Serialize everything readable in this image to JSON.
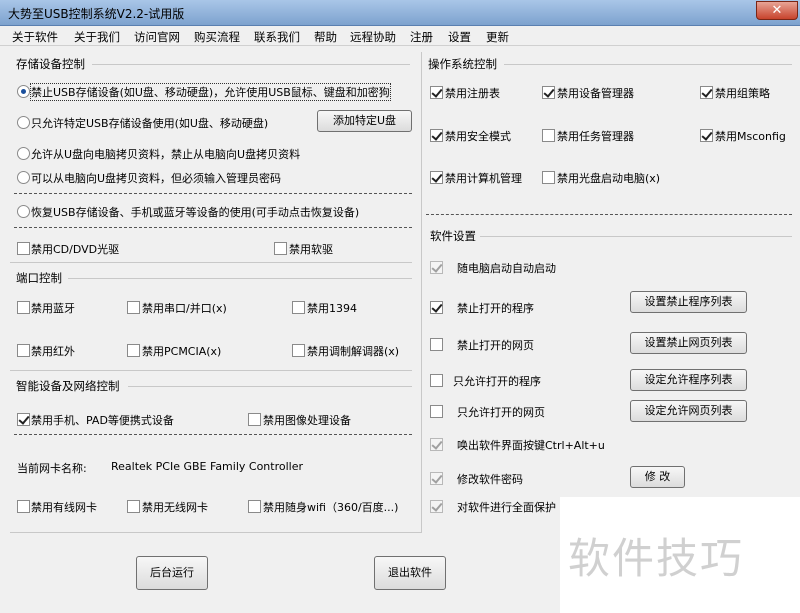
{
  "window": {
    "title": "大势至USB控制系统V2.2-试用版",
    "close_label": "✕"
  },
  "menu": [
    "关于软件",
    "关于我们",
    "访问官网",
    "购买流程",
    "联系我们",
    "帮助",
    "远程协助",
    "注册",
    "设置",
    "更新"
  ],
  "storage": {
    "title": "存储设备控制",
    "radios": [
      {
        "label": "禁止USB存储设备(如U盘、移动硬盘)，允许使用USB鼠标、键盘和加密狗",
        "checked": true
      },
      {
        "label": "只允许特定USB存储设备使用(如U盘、移动硬盘)",
        "checked": false
      },
      {
        "label": "允许从U盘向电脑拷贝资料，禁止从电脑向U盘拷贝资料",
        "checked": false
      },
      {
        "label": "可以从电脑向U盘拷贝资料，但必须输入管理员密码",
        "checked": false
      },
      {
        "label": "恢复USB存储设备、手机或蓝牙等设备的使用(可手动点击恢复设备)",
        "checked": false
      }
    ],
    "add_specific_button": "添加特定U盘",
    "cd_dvd": {
      "label": "禁用CD/DVD光驱",
      "checked": false
    },
    "floppy": {
      "label": "禁用软驱",
      "checked": false
    }
  },
  "ports": {
    "title": "端口控制",
    "items": [
      {
        "label": "禁用蓝牙",
        "checked": false
      },
      {
        "label": "禁用串口/并口(x)",
        "checked": false
      },
      {
        "label": "禁用1394",
        "checked": false
      },
      {
        "label": "禁用红外",
        "checked": false
      },
      {
        "label": "禁用PCMCIA(x)",
        "checked": false
      },
      {
        "label": "禁用调制解调器(x)",
        "checked": false
      }
    ]
  },
  "smart": {
    "title": "智能设备及网络控制",
    "portable": {
      "label": "禁用手机、PAD等便携式设备",
      "checked": true
    },
    "imaging": {
      "label": "禁用图像处理设备",
      "checked": false
    },
    "nic_label": "当前网卡名称:",
    "nic_value": "Realtek PCIe GBE Family Controller",
    "net_items": [
      {
        "label": "禁用有线网卡",
        "checked": false
      },
      {
        "label": "禁用无线网卡",
        "checked": false
      },
      {
        "label": "禁用随身wifi（360/百度...)",
        "checked": false
      }
    ]
  },
  "os": {
    "title": "操作系统控制",
    "items": [
      {
        "label": "禁用注册表",
        "checked": true
      },
      {
        "label": "禁用设备管理器",
        "checked": true
      },
      {
        "label": "禁用组策略",
        "checked": true
      },
      {
        "label": "禁用安全模式",
        "checked": true
      },
      {
        "label": "禁用任务管理器",
        "checked": false
      },
      {
        "label": "禁用Msconfig",
        "checked": true
      },
      {
        "label": "禁用计算机管理",
        "checked": true
      },
      {
        "label": "禁用光盘启动电脑(x)",
        "checked": false
      }
    ]
  },
  "software": {
    "title": "软件设置",
    "items": [
      {
        "label": "随电脑启动自动启动",
        "checked": true,
        "disabled": true
      },
      {
        "label": "禁止打开的程序",
        "checked": true,
        "disabled": false,
        "button": "设置禁止程序列表"
      },
      {
        "label": "禁止打开的网页",
        "checked": false,
        "disabled": false,
        "button": "设置禁止网页列表"
      },
      {
        "label": "只允许打开的程序",
        "checked": false,
        "disabled": false,
        "button": "设定允许程序列表"
      },
      {
        "label": "只允许打开的网页",
        "checked": false,
        "disabled": false,
        "button": "设定允许网页列表"
      },
      {
        "label": "唤出软件界面按键Ctrl+Alt+u",
        "checked": true,
        "disabled": true
      },
      {
        "label": "修改软件密码",
        "checked": true,
        "disabled": true,
        "button": "修 改"
      },
      {
        "label": "对软件进行全面保护",
        "checked": true,
        "disabled": true
      }
    ]
  },
  "bottom": {
    "background_run": "后台运行",
    "exit": "退出软件"
  },
  "watermark": "软件技巧"
}
